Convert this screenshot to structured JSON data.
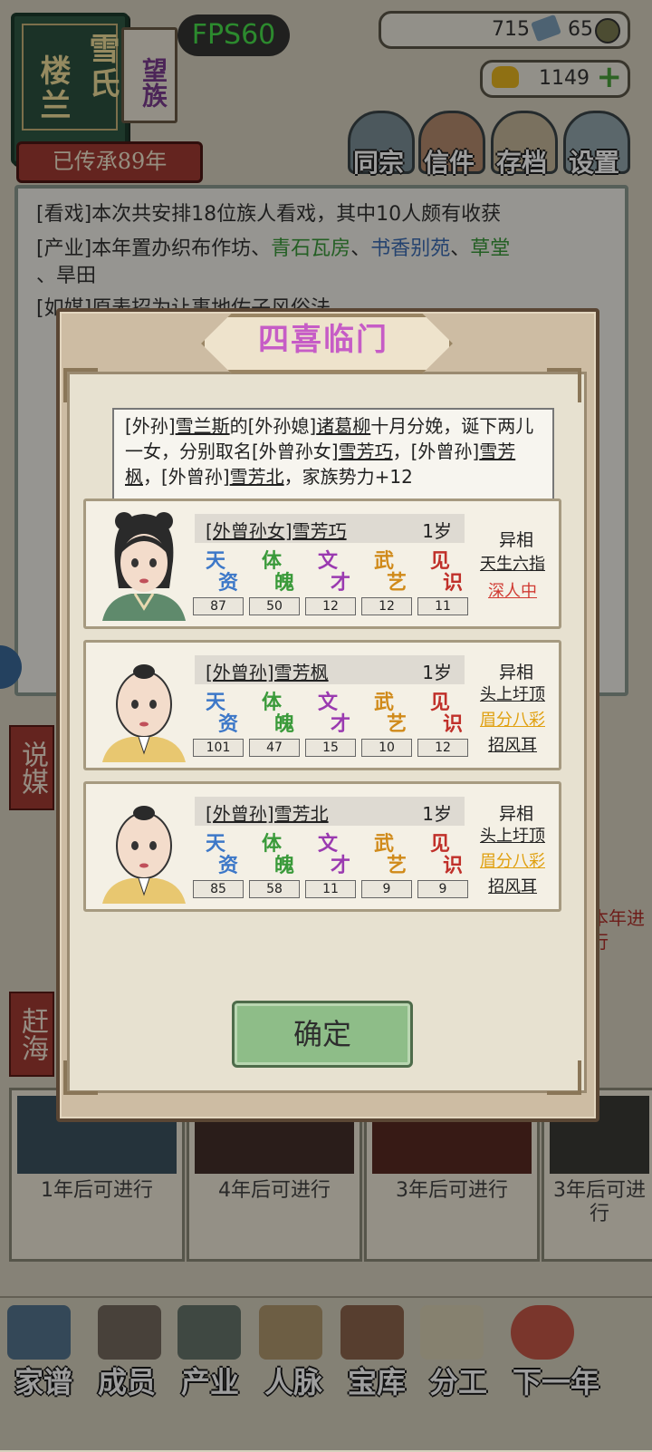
{
  "hud": {
    "clan_name_top": "雪氏",
    "clan_name_bottom": "楼兰",
    "clan_tag": "望族",
    "heritage": "已传承89年",
    "fps": "FPS60",
    "silver": "715",
    "copper": "65",
    "gold": "1149",
    "buttons": [
      "同宗",
      "信件",
      "存档",
      "设置"
    ]
  },
  "log": {
    "line1": "[看戏]本次共安排18位族人看戏，其中10人颇有收获",
    "line2_prefix": "[产业]本年置办织布作坊、",
    "line2_a": "青石瓦房",
    "line2_b": "书香别苑",
    "line2_c": "草堂",
    "line2_d": "、旱田",
    "line3": "[如媒]原表招为让事地佐子风俗法",
    "side_left_1": "说媒",
    "side_left_2": "赶海",
    "side_right": "本年进行",
    "event_cards": [
      "1年后可进行",
      "4年后可进行",
      "3年后可进行",
      "3年后可进行"
    ]
  },
  "bottom_nav": [
    "家谱",
    "成员",
    "产业",
    "人脉",
    "宝库",
    "分工",
    "下一年"
  ],
  "modal": {
    "title": "四喜临门",
    "announce_1": "[外孙]",
    "announce_2": "雪兰斯",
    "announce_3": "的[外孙媳]",
    "announce_4": "诸葛柳",
    "announce_5": "十月分娩，诞下两儿一女，分别取名[外曾孙女]",
    "announce_6": "雪芳巧",
    "announce_7": "，[外曾孙]",
    "announce_8": "雪芳枫",
    "announce_9": "，[外曾孙]",
    "announce_10": "雪芳北",
    "announce_11": "，家族势力+12",
    "stat_labels": [
      [
        "天",
        "资"
      ],
      [
        "体",
        "魄"
      ],
      [
        "文",
        "才"
      ],
      [
        "武",
        "艺"
      ],
      [
        "见",
        "识"
      ]
    ],
    "trait_head": "异相",
    "confirm": "确定",
    "members": [
      {
        "name": "[外曾孙女]雪芳巧",
        "age": "1岁",
        "stats": [
          "87",
          "50",
          "12",
          "12",
          "11"
        ],
        "traits": [
          "天生六指",
          "深人中"
        ]
      },
      {
        "name": "[外曾孙]雪芳枫",
        "age": "1岁",
        "stats": [
          "101",
          "47",
          "15",
          "10",
          "12"
        ],
        "traits": [
          "头上圩顶",
          "眉分八彩",
          "招风耳"
        ]
      },
      {
        "name": "[外曾孙]雪芳北",
        "age": "1岁",
        "stats": [
          "85",
          "58",
          "11",
          "9",
          "9"
        ],
        "traits": [
          "头上圩顶",
          "眉分八彩",
          "招风耳"
        ]
      }
    ]
  }
}
